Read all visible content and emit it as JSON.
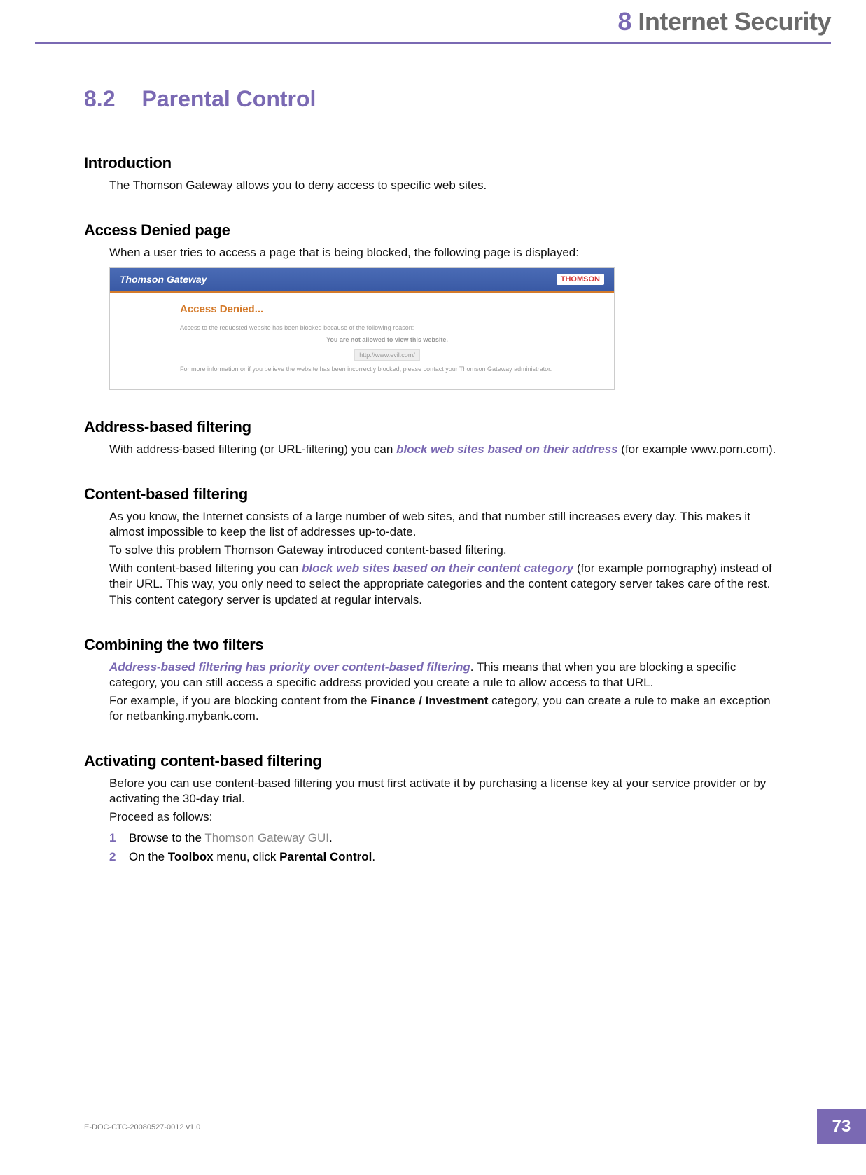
{
  "header": {
    "chapter_number": "8",
    "chapter_title": "Internet Security"
  },
  "section": {
    "number": "8.2",
    "title": "Parental Control"
  },
  "intro": {
    "heading": "Introduction",
    "p1": "The Thomson Gateway allows you to deny access to specific web sites."
  },
  "denied": {
    "heading": "Access Denied page",
    "p1": "When a user tries to access a page that is being blocked, the following page is displayed:",
    "shot": {
      "bar_title": "Thomson Gateway",
      "bar_logo": "THOMSON",
      "h": "Access Denied...",
      "line1": "Access to the requested website has been blocked because of the following reason:",
      "line2": "You are not allowed to view this website.",
      "url": "http://www.evil.com/",
      "line3": "For more information or if you believe the website has been incorrectly blocked, please contact your Thomson Gateway administrator."
    }
  },
  "address": {
    "heading": "Address-based filtering",
    "p1a": "With address-based filtering (or URL-filtering) you can ",
    "p1b": "block web sites based on their address",
    "p1c": " (for example www.porn.com)."
  },
  "contentf": {
    "heading": "Content-based filtering",
    "p1": "As you know, the Internet consists of a large number of web sites, and that number still increases every day. This makes it almost impossible to keep the list of addresses up-to-date.",
    "p2": "To solve this problem Thomson Gateway introduced content-based filtering.",
    "p3a": "With content-based filtering you can ",
    "p3b": "block web sites based on their content category",
    "p3c": " (for example pornography) instead of their URL. This way, you only need to select the appropriate categories and the content category server takes care of the rest. This content category server is updated at regular intervals."
  },
  "combine": {
    "heading": "Combining the two filters",
    "p1a": "Address-based filtering has priority over content-based filtering",
    "p1b": ". This means that when you are blocking a specific category, you can still access a specific address provided you create a rule to allow access to that URL.",
    "p2a": "For example, if you are blocking content from the ",
    "p2b": "Finance / Investment",
    "p2c": " category, you can create a rule to make an exception for netbanking.mybank.com."
  },
  "activate": {
    "heading": "Activating content-based filtering",
    "p1": "Before you can use content-based filtering you must first activate it by purchasing a license key at your service provider or by activating the 30-day trial.",
    "p2": "Proceed as follows:",
    "step1": {
      "num": "1",
      "a": "Browse to the ",
      "b": "Thomson Gateway GUI",
      "c": "."
    },
    "step2": {
      "num": "2",
      "a": "On the ",
      "b": "Toolbox",
      "c": " menu, click ",
      "d": "Parental Control",
      "e": "."
    }
  },
  "footer": {
    "docid": "E-DOC-CTC-20080527-0012 v1.0",
    "page": "73"
  }
}
